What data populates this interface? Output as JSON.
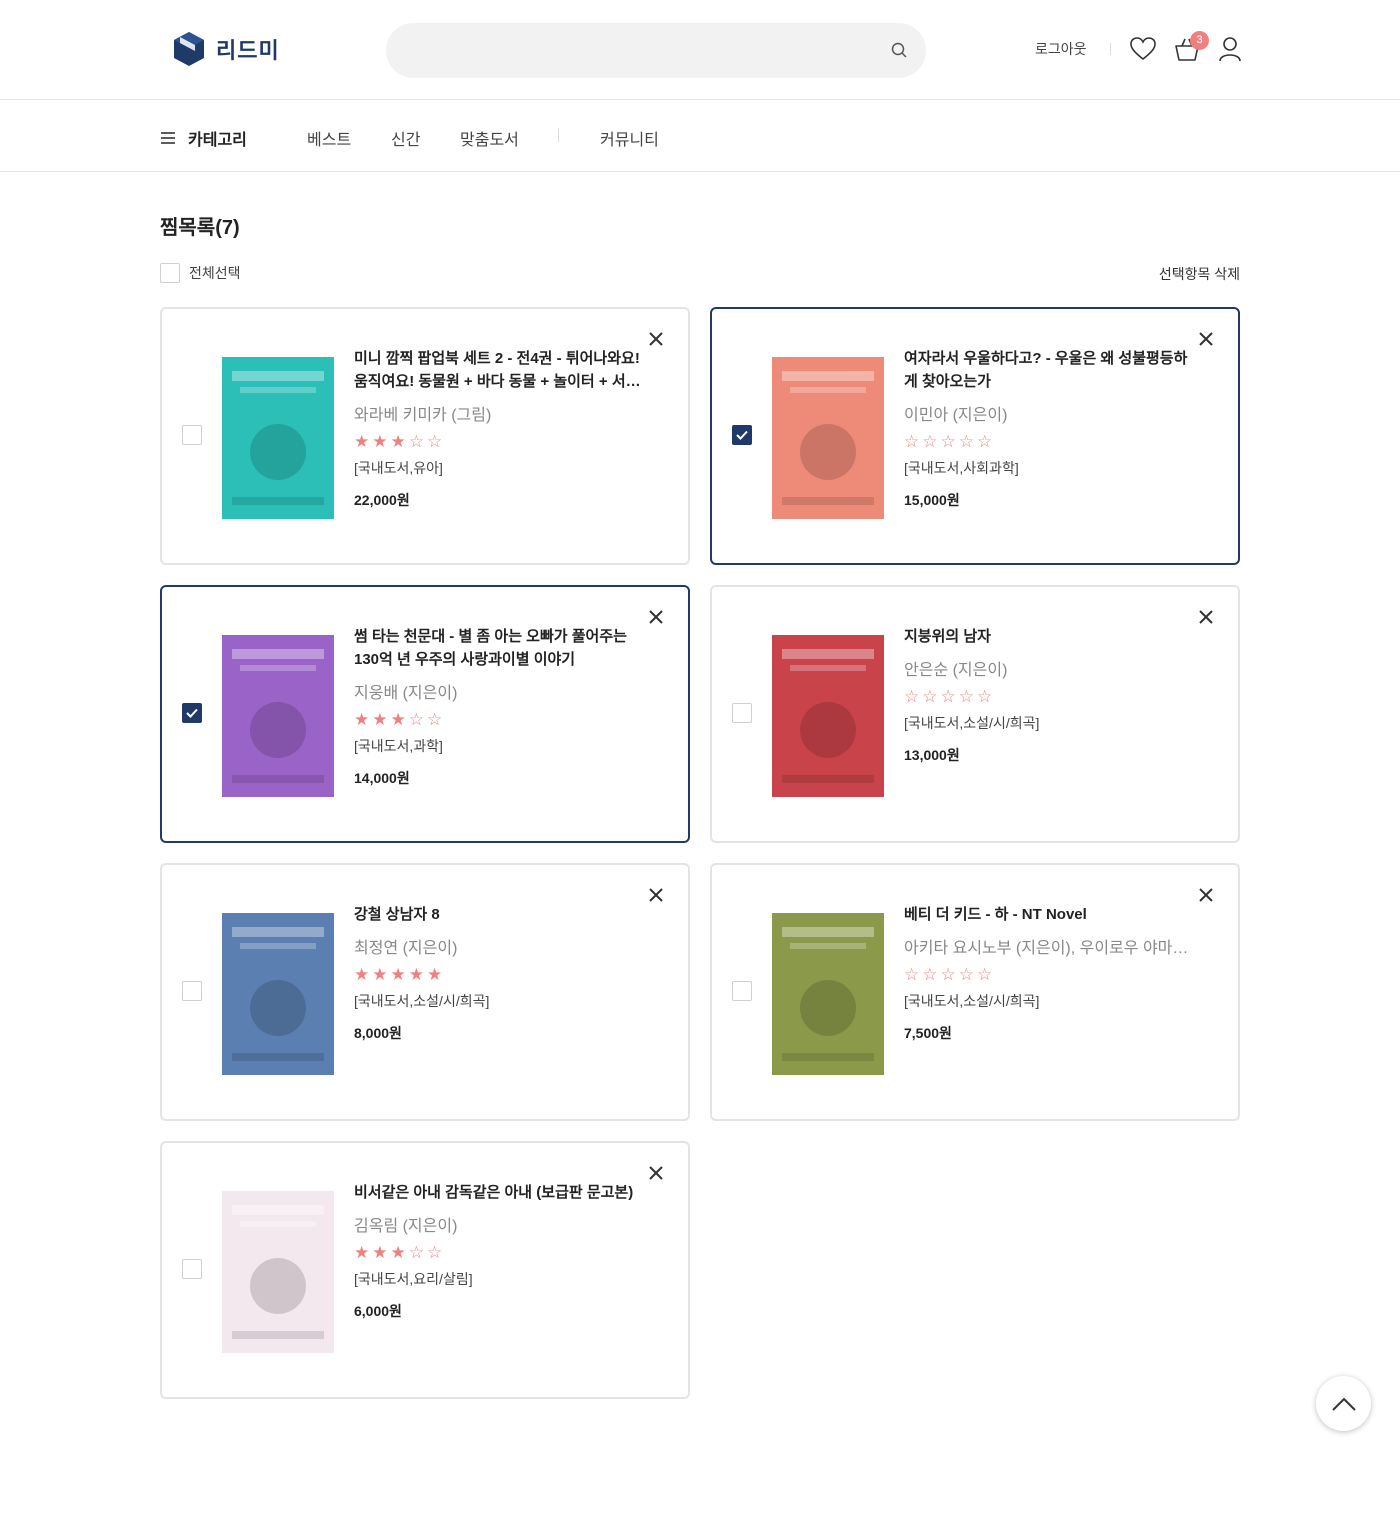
{
  "header": {
    "logo_text": "리드미",
    "search_placeholder": "",
    "logout_label": "로그아웃",
    "cart_count": "3"
  },
  "nav": {
    "category_label": "카테고리",
    "items": [
      "베스트",
      "신간",
      "맞춤도서",
      "커뮤니티"
    ]
  },
  "wishlist": {
    "title": "찜목록(7)",
    "select_all_label": "전체선택",
    "delete_selected_label": "선택항목 삭제",
    "items": [
      {
        "title": "미니 깜찍 팝업북 세트 2 - 전4권 - 튀어나와요! 움직여요! 동물원 + 바다 동물 + 놀이터 + 서커스",
        "author": "와라베 키미카 (그림)",
        "rating": 3,
        "category": "[국내도서,유아]",
        "price": "22,000원",
        "selected": false,
        "cover_color": "#2bbfb8"
      },
      {
        "title": "여자라서 우울하다고? - 우울은 왜 성불평등하게 찾아오는가",
        "author": "이민아 (지은이)",
        "rating": 0,
        "category": "[국내도서,사회과학]",
        "price": "15,000원",
        "selected": true,
        "cover_color": "#ee8a78"
      },
      {
        "title": "썸 타는 천문대 - 별 좀 아는 오빠가 풀어주는 130억 년 우주의 사랑과이별 이야기",
        "author": "지웅배 (지은이)",
        "rating": 3,
        "category": "[국내도서,과학]",
        "price": "14,000원",
        "selected": true,
        "cover_color": "#9a63c8"
      },
      {
        "title": "지붕위의 남자",
        "author": "안은순 (지은이)",
        "rating": 0,
        "category": "[국내도서,소설/시/희곡]",
        "price": "13,000원",
        "selected": false,
        "cover_color": "#c9444a"
      },
      {
        "title": "강철 상남자 8",
        "author": "최정연 (지은이)",
        "rating": 5,
        "category": "[국내도서,소설/시/희곡]",
        "price": "8,000원",
        "selected": false,
        "cover_color": "#5a7fb0"
      },
      {
        "title": "베티 더 키드 - 하 - NT Novel",
        "author": "아키타 요시노부 (지은이), 우이로우 야마다 (그림)",
        "rating": 0,
        "category": "[국내도서,소설/시/희곡]",
        "price": "7,500원",
        "selected": false,
        "cover_color": "#8a9a4a"
      },
      {
        "title": "비서같은 아내 감독같은 아내 (보급판 문고본)",
        "author": "김옥림 (지은이)",
        "rating": 3,
        "category": "[국내도서,요리/살림]",
        "price": "6,000원",
        "selected": false,
        "cover_color": "#f4e8ef"
      }
    ]
  },
  "accent_color": "#1f3a68",
  "star_color": "#f08080"
}
